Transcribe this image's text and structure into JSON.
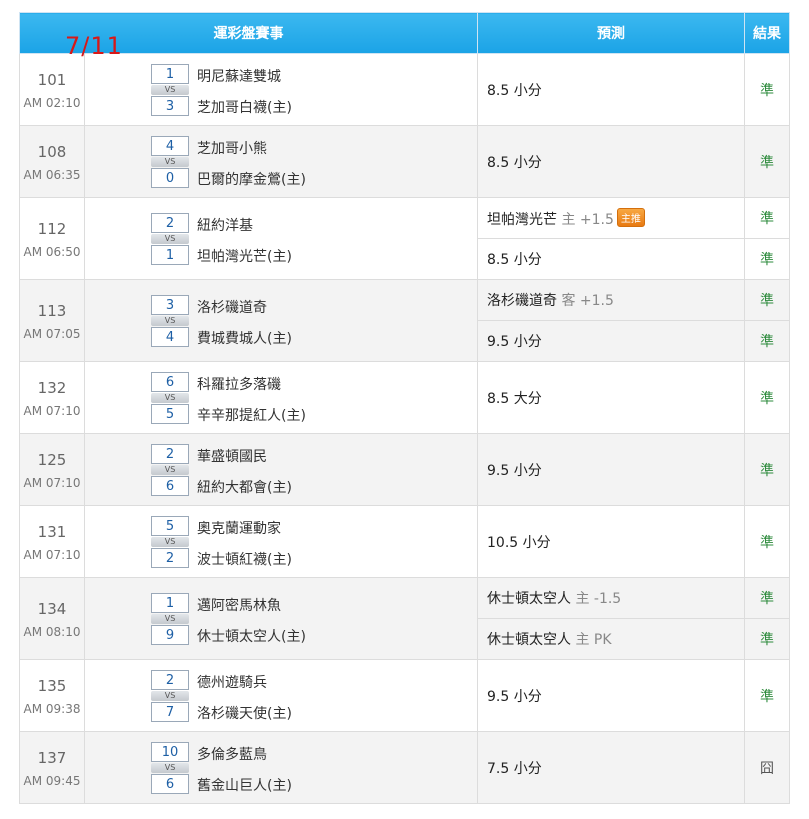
{
  "date": "7/11",
  "header": {
    "match": "運彩盤賽事",
    "prediction": "預測",
    "result": "結果"
  },
  "vs_label": "VS",
  "games": [
    {
      "id": "101",
      "time": "AM 02:10",
      "away_score": "1",
      "home_score": "3",
      "away": "明尼蘇達雙城",
      "home": "芝加哥白襪(主)",
      "preds": [
        {
          "text": "8.5 小分",
          "result": "準"
        }
      ]
    },
    {
      "id": "108",
      "time": "AM 06:35",
      "away_score": "4",
      "home_score": "0",
      "away": "芝加哥小熊",
      "home": "巴爾的摩金鶯(主)",
      "preds": [
        {
          "text": "8.5 小分",
          "result": "準"
        }
      ]
    },
    {
      "id": "112",
      "time": "AM 06:50",
      "away_score": "2",
      "home_score": "1",
      "away": "紐約洋基",
      "home": "坦帕灣光芒(主)",
      "preds": [
        {
          "text": "坦帕灣光芒",
          "side": "主 +1.5",
          "tag": "主推",
          "result": "準"
        },
        {
          "text": "8.5 小分",
          "result": "準"
        }
      ]
    },
    {
      "id": "113",
      "time": "AM 07:05",
      "away_score": "3",
      "home_score": "4",
      "away": "洛杉磯道奇",
      "home": "費城費城人(主)",
      "preds": [
        {
          "text": "洛杉磯道奇",
          "side": "客 +1.5",
          "result": "準"
        },
        {
          "text": "9.5 小分",
          "result": "準"
        }
      ]
    },
    {
      "id": "132",
      "time": "AM 07:10",
      "away_score": "6",
      "home_score": "5",
      "away": "科羅拉多落磯",
      "home": "辛辛那提紅人(主)",
      "preds": [
        {
          "text": "8.5 大分",
          "result": "準"
        }
      ]
    },
    {
      "id": "125",
      "time": "AM 07:10",
      "away_score": "2",
      "home_score": "6",
      "away": "華盛頓國民",
      "home": "紐約大都會(主)",
      "preds": [
        {
          "text": "9.5 小分",
          "result": "準"
        }
      ]
    },
    {
      "id": "131",
      "time": "AM 07:10",
      "away_score": "5",
      "home_score": "2",
      "away": "奧克蘭運動家",
      "home": "波士頓紅襪(主)",
      "preds": [
        {
          "text": "10.5 小分",
          "result": "準"
        }
      ]
    },
    {
      "id": "134",
      "time": "AM 08:10",
      "away_score": "1",
      "home_score": "9",
      "away": "邁阿密馬林魚",
      "home": "休士頓太空人(主)",
      "preds": [
        {
          "text": "休士頓太空人",
          "side": "主 -1.5",
          "result": "準"
        },
        {
          "text": "休士頓太空人",
          "side": "主 PK",
          "result": "準"
        }
      ]
    },
    {
      "id": "135",
      "time": "AM 09:38",
      "away_score": "2",
      "home_score": "7",
      "away": "德州遊騎兵",
      "home": "洛杉磯天使(主)",
      "preds": [
        {
          "text": "9.5 小分",
          "result": "準"
        }
      ]
    },
    {
      "id": "137",
      "time": "AM 09:45",
      "away_score": "10",
      "home_score": "6",
      "away": "多倫多藍鳥",
      "home": "舊金山巨人(主)",
      "preds": [
        {
          "text": "7.5 小分",
          "result": "囧"
        }
      ]
    }
  ]
}
